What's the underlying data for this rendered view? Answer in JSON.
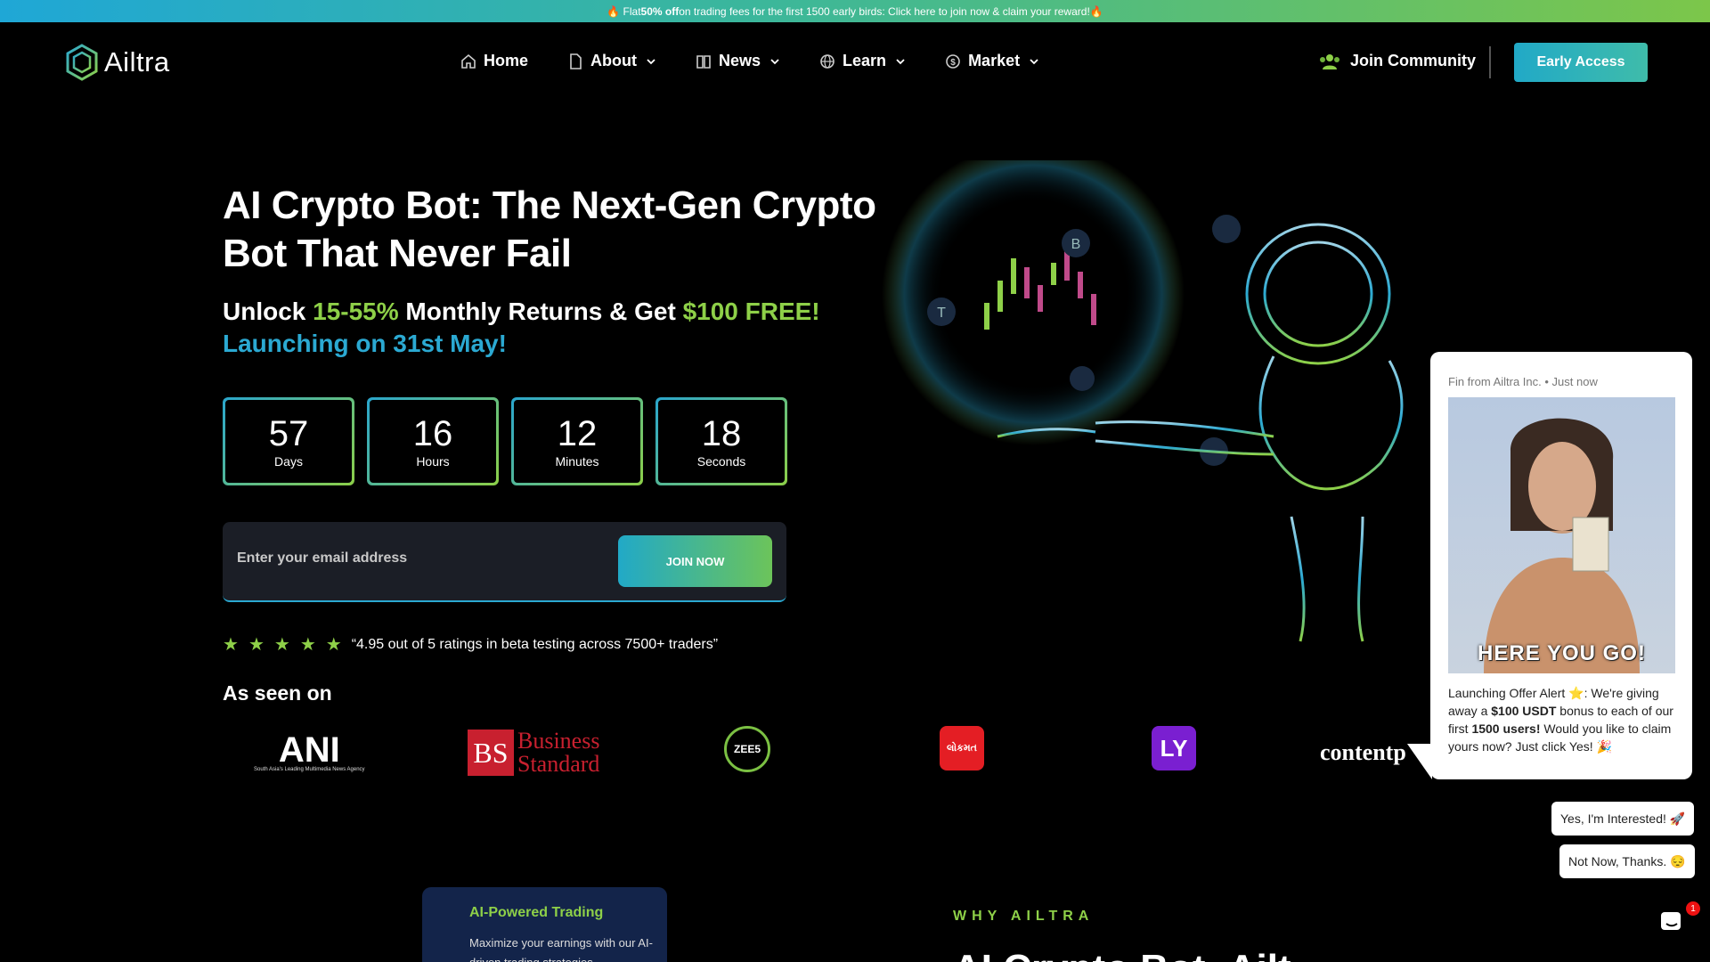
{
  "promo": {
    "prefix": "🔥 Flat ",
    "bold": "50% off",
    "suffix": " on trading fees for the first 1500 early birds: Click here to join now & claim your reward!🔥"
  },
  "header": {
    "logo_text": "Ailtra",
    "nav": [
      {
        "label": "Home",
        "icon": "home-icon"
      },
      {
        "label": "About",
        "icon": "document-icon"
      },
      {
        "label": "News",
        "icon": "book-icon"
      },
      {
        "label": "Learn",
        "icon": "globe-icon"
      },
      {
        "label": "Market",
        "icon": "dollar-icon"
      }
    ],
    "join_community": "Join Community",
    "early_access": "Early Access"
  },
  "hero": {
    "title": "AI Crypto Bot: The Next-Gen Crypto Bot That Never Fail",
    "sub_unlock": "Unlock ",
    "sub_range": "15-55%",
    "sub_mid": " Monthly Returns & Get ",
    "sub_free": "$100 FREE!",
    "sub_launch": "Launching on 31st May!",
    "countdown": [
      {
        "value": "57",
        "label": "Days"
      },
      {
        "value": "16",
        "label": "Hours"
      },
      {
        "value": "12",
        "label": "Minutes"
      },
      {
        "value": "18",
        "label": "Seconds"
      }
    ],
    "email_placeholder": "Enter your email address",
    "join_now": "JOIN NOW",
    "rating_text": "“4.95 out of 5 ratings in beta testing across 7500+ traders”",
    "stars": 5
  },
  "seen": {
    "title": "As seen on",
    "ani": "ANI",
    "ani_tag": "South Asia's Leading Multimedia News Agency",
    "bs_mark": "BS",
    "bs_line1": "Business",
    "bs_line2": "Standard",
    "zee": "ZEE5",
    "lokmat": "લોકમત",
    "ly": "LY",
    "content": "contentp"
  },
  "lower": {
    "card_title": "AI-Powered Trading",
    "card_text": "Maximize your earnings with our AI-driven trading strategies",
    "why": "WHY AILTRA",
    "why_head": "AI Crypto Bot: Ailt"
  },
  "chat": {
    "from": "Fin from Ailtra Inc. • Just now",
    "image_caption": "HERE YOU GO!",
    "msg_a": "Launching Offer Alert ⭐: We're giving away a ",
    "msg_b": "$100 USDT",
    "msg_c": " bonus to each of our first ",
    "msg_d": "1500 users!",
    "msg_e": " Would you like to claim yours now? Just click Yes! 🎉",
    "reply_yes": "Yes, I'm Interested! 🚀",
    "reply_no": "Not Now, Thanks. 😔",
    "unread": "1"
  },
  "colors": {
    "accent_green": "#8ed048",
    "accent_blue": "#2ba9d2"
  }
}
